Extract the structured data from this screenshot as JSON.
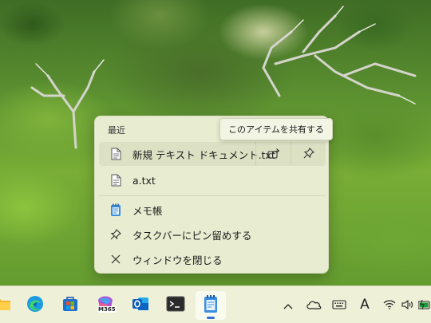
{
  "jumplist": {
    "section_title": "最近",
    "recent": [
      {
        "label": "新規 テキスト ドキュメント.txt",
        "icon": "text-file-icon"
      },
      {
        "label": "a.txt",
        "icon": "text-file-icon"
      }
    ],
    "tasks": [
      {
        "label": "メモ帳",
        "icon": "notepad-icon"
      },
      {
        "label": "タスクバーにピン留めする",
        "icon": "pin-icon"
      },
      {
        "label": "ウィンドウを閉じる",
        "icon": "close-icon"
      }
    ],
    "tooltip": "このアイテムを共有する"
  },
  "taskbar": {
    "apps": [
      {
        "name": "file-explorer",
        "icon": "folder-icon"
      },
      {
        "name": "edge",
        "icon": "edge-icon"
      },
      {
        "name": "microsoft-store",
        "icon": "store-icon"
      },
      {
        "name": "microsoft-365",
        "icon": "m365-icon",
        "badge": "M365"
      },
      {
        "name": "outlook",
        "icon": "outlook-icon"
      },
      {
        "name": "terminal",
        "icon": "terminal-icon"
      },
      {
        "name": "notepad",
        "icon": "notepad-icon",
        "active": true
      }
    ],
    "tray": [
      "chevron-up-icon",
      "onedrive-icon",
      "keyboard-icon",
      "ime-icon",
      "wifi-icon",
      "volume-icon",
      "battery-icon"
    ],
    "ime_label": "A"
  },
  "colors": {
    "accent": "#2f6fd6",
    "menu_bg": "#e8ecd0",
    "taskbar_bg": "#eef0d8"
  }
}
